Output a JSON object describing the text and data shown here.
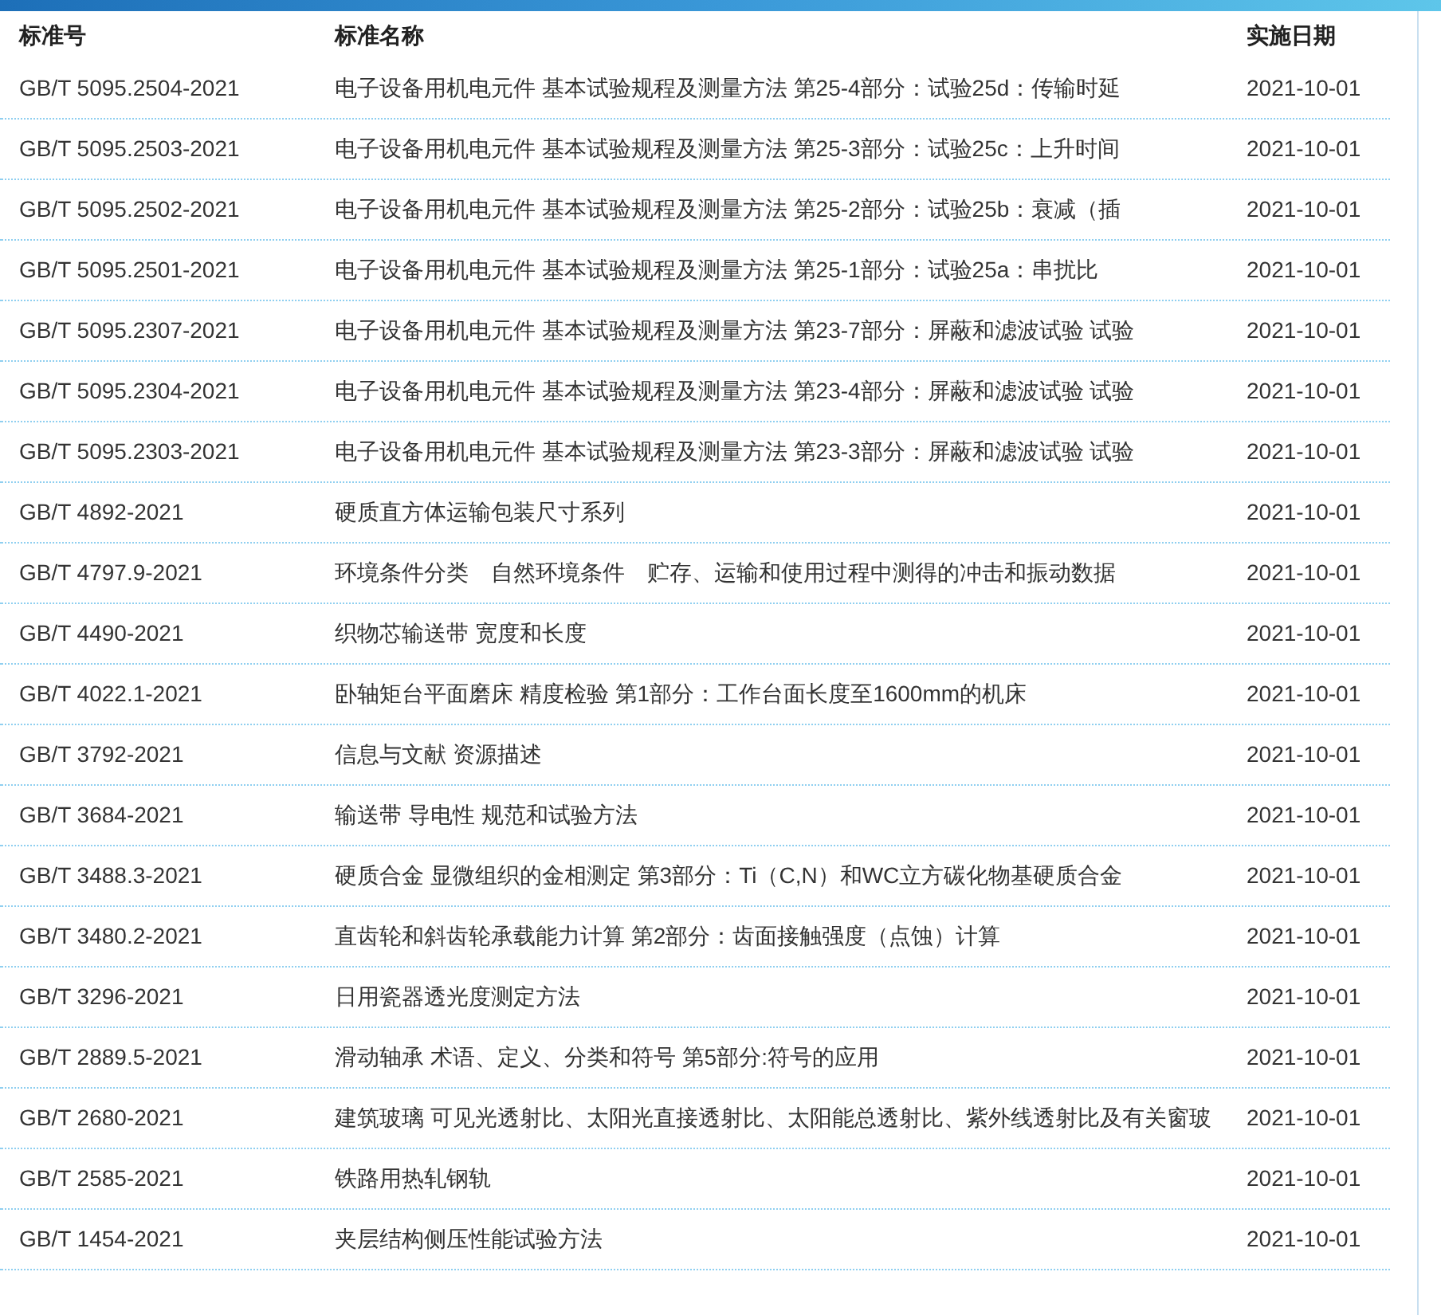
{
  "table": {
    "columns": [
      "标准号",
      "标准名称",
      "实施日期"
    ],
    "rows": [
      {
        "code": "GB/T 5095.2504-2021",
        "name": "电子设备用机电元件 基本试验规程及测量方法 第25-4部分：试验25d：传输时延",
        "date": "2021-10-01"
      },
      {
        "code": "GB/T 5095.2503-2021",
        "name": "电子设备用机电元件 基本试验规程及测量方法 第25-3部分：试验25c：上升时间",
        "date": "2021-10-01"
      },
      {
        "code": "GB/T 5095.2502-2021",
        "name": "电子设备用机电元件 基本试验规程及测量方法 第25-2部分：试验25b：衰减（插",
        "date": "2021-10-01"
      },
      {
        "code": "GB/T 5095.2501-2021",
        "name": "电子设备用机电元件 基本试验规程及测量方法 第25-1部分：试验25a：串扰比",
        "date": "2021-10-01"
      },
      {
        "code": "GB/T 5095.2307-2021",
        "name": "电子设备用机电元件 基本试验规程及测量方法 第23-7部分：屏蔽和滤波试验 试验",
        "date": "2021-10-01"
      },
      {
        "code": "GB/T 5095.2304-2021",
        "name": "电子设备用机电元件 基本试验规程及测量方法 第23-4部分：屏蔽和滤波试验 试验",
        "date": "2021-10-01"
      },
      {
        "code": "GB/T 5095.2303-2021",
        "name": "电子设备用机电元件 基本试验规程及测量方法 第23-3部分：屏蔽和滤波试验 试验",
        "date": "2021-10-01"
      },
      {
        "code": "GB/T 4892-2021",
        "name": "硬质直方体运输包装尺寸系列",
        "date": "2021-10-01"
      },
      {
        "code": "GB/T 4797.9-2021",
        "name": "环境条件分类　自然环境条件　贮存、运输和使用过程中测得的冲击和振动数据",
        "date": "2021-10-01"
      },
      {
        "code": "GB/T 4490-2021",
        "name": "织物芯输送带 宽度和长度",
        "date": "2021-10-01"
      },
      {
        "code": "GB/T 4022.1-2021",
        "name": "卧轴矩台平面磨床 精度检验 第1部分：工作台面长度至1600mm的机床",
        "date": "2021-10-01"
      },
      {
        "code": "GB/T 3792-2021",
        "name": "信息与文献 资源描述",
        "date": "2021-10-01"
      },
      {
        "code": "GB/T 3684-2021",
        "name": "输送带 导电性 规范和试验方法",
        "date": "2021-10-01"
      },
      {
        "code": "GB/T 3488.3-2021",
        "name": "硬质合金 显微组织的金相测定 第3部分：Ti（C,N）和WC立方碳化物基硬质合金",
        "date": "2021-10-01"
      },
      {
        "code": "GB/T 3480.2-2021",
        "name": "直齿轮和斜齿轮承载能力计算 第2部分：齿面接触强度（点蚀）计算",
        "date": "2021-10-01"
      },
      {
        "code": "GB/T 3296-2021",
        "name": "日用瓷器透光度测定方法",
        "date": "2021-10-01"
      },
      {
        "code": "GB/T 2889.5-2021",
        "name": "滑动轴承 术语、定义、分类和符号 第5部分:符号的应用",
        "date": "2021-10-01"
      },
      {
        "code": "GB/T 2680-2021",
        "name": "建筑玻璃 可见光透射比、太阳光直接透射比、太阳能总透射比、紫外线透射比及有关窗玻",
        "date": "2021-10-01"
      },
      {
        "code": "GB/T 2585-2021",
        "name": "铁路用热轧钢轨",
        "date": "2021-10-01"
      },
      {
        "code": "GB/T 1454-2021",
        "name": "夹层结构侧压性能试验方法",
        "date": "2021-10-01"
      }
    ]
  }
}
